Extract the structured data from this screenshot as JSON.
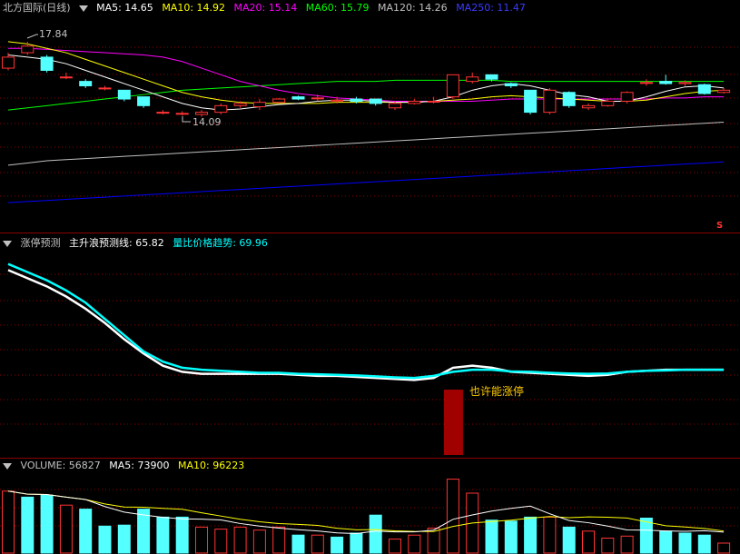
{
  "stock": {
    "name": "北方国际",
    "period": "(日线)",
    "title_color": "#c0c0c0"
  },
  "price_panel": {
    "indicators": [
      {
        "label": "MA5: 14.65",
        "color": "#ffffff"
      },
      {
        "label": "MA10: 14.92",
        "color": "#ffff00"
      },
      {
        "label": "MA20: 15.14",
        "color": "#ff00ff"
      },
      {
        "label": "MA60: 15.79",
        "color": "#00ff00"
      },
      {
        "label": "MA120: 14.26",
        "color": "#c0c0c0"
      },
      {
        "label": "MA250: 11.47",
        "color": "#0000ff"
      }
    ],
    "high_marker": "17.84",
    "low_marker": "14.09",
    "corner_mark": "S"
  },
  "indicator_panel": {
    "name": "涨停预测",
    "lines": [
      {
        "label": "主升浪预测线: 65.82",
        "color": "#ffffff"
      },
      {
        "label": "量比价格趋势: 69.96",
        "color": "#00ffff"
      }
    ],
    "signal_text": "也许能涨停",
    "signal_color": "#ffcc00"
  },
  "volume_panel": {
    "name": "VOLUME: 56827",
    "indicators": [
      {
        "label": "MA5: 73900",
        "color": "#ffffff"
      },
      {
        "label": "MA10: 96223",
        "color": "#ffff00"
      }
    ]
  },
  "colors": {
    "up": "#ff3333",
    "down": "#54ffff",
    "separator": "#8b0000",
    "grid": "#8b0000"
  },
  "candles": [
    {
      "o": 15.6,
      "c": 16.1,
      "h": 16.3,
      "l": 15.5
    },
    {
      "o": 16.3,
      "c": 16.6,
      "h": 16.8,
      "l": 16.2
    },
    {
      "o": 16.1,
      "c": 15.5,
      "h": 16.2,
      "l": 15.4
    },
    {
      "o": 15.2,
      "c": 15.2,
      "h": 15.4,
      "l": 15.1
    },
    {
      "o": 15.0,
      "c": 14.8,
      "h": 15.1,
      "l": 14.7
    },
    {
      "o": 14.7,
      "c": 14.7,
      "h": 14.8,
      "l": 14.6
    },
    {
      "o": 14.6,
      "c": 14.2,
      "h": 14.6,
      "l": 14.1
    },
    {
      "o": 14.3,
      "c": 13.9,
      "h": 14.3,
      "l": 13.8
    },
    {
      "o": 13.6,
      "c": 13.6,
      "h": 13.7,
      "l": 13.5
    },
    {
      "o": 13.55,
      "c": 13.55,
      "h": 13.65,
      "l": 13.45
    },
    {
      "o": 13.5,
      "c": 13.6,
      "h": 13.7,
      "l": 13.4
    },
    {
      "o": 13.6,
      "c": 13.9,
      "h": 14.0,
      "l": 13.5
    },
    {
      "o": 13.9,
      "c": 14.0,
      "h": 14.1,
      "l": 13.8
    },
    {
      "o": 13.85,
      "c": 14.05,
      "h": 14.2,
      "l": 13.7
    },
    {
      "o": 14.05,
      "c": 14.2,
      "h": 14.25,
      "l": 14.0
    },
    {
      "o": 14.3,
      "c": 14.2,
      "h": 14.35,
      "l": 14.15
    },
    {
      "o": 14.25,
      "c": 14.25,
      "h": 14.4,
      "l": 14.1
    },
    {
      "o": 14.15,
      "c": 14.15,
      "h": 14.3,
      "l": 14.0
    },
    {
      "o": 14.2,
      "c": 14.1,
      "h": 14.3,
      "l": 14.0
    },
    {
      "o": 14.2,
      "c": 14.0,
      "h": 14.2,
      "l": 13.9
    },
    {
      "o": 13.8,
      "c": 14.0,
      "h": 14.1,
      "l": 13.7
    },
    {
      "o": 14.0,
      "c": 14.1,
      "h": 14.2,
      "l": 13.95
    },
    {
      "o": 14.1,
      "c": 14.1,
      "h": 14.3,
      "l": 14.0
    },
    {
      "o": 14.3,
      "c": 15.3,
      "h": 15.3,
      "l": 14.2
    },
    {
      "o": 15.0,
      "c": 15.2,
      "h": 15.4,
      "l": 14.9
    },
    {
      "o": 15.3,
      "c": 15.1,
      "h": 15.3,
      "l": 15.0
    },
    {
      "o": 14.9,
      "c": 14.8,
      "h": 14.95,
      "l": 14.7
    },
    {
      "o": 14.6,
      "c": 13.6,
      "h": 14.6,
      "l": 13.5
    },
    {
      "o": 13.6,
      "c": 14.6,
      "h": 14.7,
      "l": 13.5
    },
    {
      "o": 14.5,
      "c": 13.9,
      "h": 14.55,
      "l": 13.8
    },
    {
      "o": 13.8,
      "c": 13.9,
      "h": 14.0,
      "l": 13.7
    },
    {
      "o": 13.9,
      "c": 14.1,
      "h": 14.2,
      "l": 13.85
    },
    {
      "o": 14.1,
      "c": 14.5,
      "h": 14.55,
      "l": 14.0
    },
    {
      "o": 14.95,
      "c": 14.95,
      "h": 15.1,
      "l": 14.8
    },
    {
      "o": 15.0,
      "c": 14.9,
      "h": 15.3,
      "l": 14.85
    },
    {
      "o": 14.9,
      "c": 14.95,
      "h": 15.05,
      "l": 14.8
    },
    {
      "o": 14.85,
      "c": 14.45,
      "h": 14.9,
      "l": 14.4
    },
    {
      "o": 14.5,
      "c": 14.6,
      "h": 14.7,
      "l": 14.45
    }
  ],
  "volume_bars": [
    {
      "v": 62,
      "up": true
    },
    {
      "v": 56,
      "up": false
    },
    {
      "v": 58,
      "up": false
    },
    {
      "v": 48,
      "up": true
    },
    {
      "v": 44,
      "up": false
    },
    {
      "v": 27,
      "up": false
    },
    {
      "v": 28,
      "up": false
    },
    {
      "v": 44,
      "up": false
    },
    {
      "v": 36,
      "up": false
    },
    {
      "v": 36,
      "up": false
    },
    {
      "v": 26,
      "up": true
    },
    {
      "v": 24,
      "up": true
    },
    {
      "v": 26,
      "up": true
    },
    {
      "v": 23,
      "up": true
    },
    {
      "v": 26,
      "up": true
    },
    {
      "v": 18,
      "up": false
    },
    {
      "v": 18,
      "up": true
    },
    {
      "v": 16,
      "up": false
    },
    {
      "v": 20,
      "up": false
    },
    {
      "v": 38,
      "up": false
    },
    {
      "v": 14,
      "up": true
    },
    {
      "v": 18,
      "up": true
    },
    {
      "v": 25,
      "up": true
    },
    {
      "v": 74,
      "up": true
    },
    {
      "v": 60,
      "up": true
    },
    {
      "v": 33,
      "up": false
    },
    {
      "v": 32,
      "up": false
    },
    {
      "v": 36,
      "up": false
    },
    {
      "v": 36,
      "up": true
    },
    {
      "v": 26,
      "up": false
    },
    {
      "v": 22,
      "up": true
    },
    {
      "v": 15,
      "up": true
    },
    {
      "v": 17,
      "up": true
    },
    {
      "v": 35,
      "up": false
    },
    {
      "v": 22,
      "up": false
    },
    {
      "v": 20,
      "up": false
    },
    {
      "v": 18,
      "up": false
    },
    {
      "v": 10,
      "up": true
    }
  ],
  "ma_lines": {
    "ma5": [
      16.2,
      16.1,
      16.0,
      15.8,
      15.5,
      15.2,
      14.9,
      14.6,
      14.3,
      14.0,
      13.8,
      13.7,
      13.75,
      13.85,
      13.95,
      14.0,
      14.1,
      14.15,
      14.15,
      14.1,
      14.05,
      14.05,
      14.1,
      14.3,
      14.6,
      14.8,
      14.9,
      14.8,
      14.6,
      14.4,
      14.3,
      14.1,
      14.1,
      14.3,
      14.55,
      14.75,
      14.8,
      14.7
    ],
    "ma10": [
      16.8,
      16.7,
      16.5,
      16.3,
      16.0,
      15.7,
      15.4,
      15.1,
      14.8,
      14.5,
      14.3,
      14.15,
      14.05,
      14.0,
      14.0,
      14.0,
      14.0,
      14.05,
      14.05,
      14.05,
      14.05,
      14.05,
      14.1,
      14.15,
      14.2,
      14.3,
      14.35,
      14.3,
      14.25,
      14.2,
      14.15,
      14.1,
      14.1,
      14.15,
      14.3,
      14.45,
      14.55,
      14.6
    ],
    "ma20": [
      16.5,
      16.5,
      16.45,
      16.4,
      16.35,
      16.3,
      16.25,
      16.2,
      16.1,
      15.9,
      15.6,
      15.3,
      15.0,
      14.8,
      14.6,
      14.45,
      14.35,
      14.25,
      14.2,
      14.15,
      14.1,
      14.1,
      14.1,
      14.1,
      14.1,
      14.15,
      14.2,
      14.2,
      14.2,
      14.2,
      14.2,
      14.2,
      14.2,
      14.2,
      14.25,
      14.25,
      14.3,
      14.3
    ],
    "ma60": [
      13.7,
      13.8,
      13.9,
      14.0,
      14.1,
      14.2,
      14.3,
      14.4,
      14.5,
      14.6,
      14.65,
      14.7,
      14.75,
      14.8,
      14.85,
      14.9,
      14.95,
      15.0,
      15.0,
      15.0,
      15.05,
      15.05,
      15.05,
      15.05,
      15.05,
      15.05,
      15.0,
      15.0,
      15.0,
      15.0,
      15.0,
      15.0,
      15.0,
      15.0,
      15.0,
      15.0,
      15.0,
      15.0
    ],
    "ma120": [
      11.2,
      11.3,
      11.4,
      11.45,
      11.5,
      11.55,
      11.6,
      11.65,
      11.7,
      11.75,
      11.8,
      11.85,
      11.9,
      11.95,
      12.0,
      12.05,
      12.1,
      12.15,
      12.2,
      12.25,
      12.3,
      12.35,
      12.4,
      12.45,
      12.5,
      12.55,
      12.6,
      12.65,
      12.7,
      12.75,
      12.8,
      12.85,
      12.9,
      12.95,
      13.0,
      13.05,
      13.1,
      13.15
    ],
    "ma250": [
      9.5,
      9.55,
      9.6,
      9.65,
      9.7,
      9.75,
      9.8,
      9.85,
      9.9,
      9.95,
      10.0,
      10.05,
      10.1,
      10.15,
      10.2,
      10.25,
      10.3,
      10.35,
      10.4,
      10.45,
      10.5,
      10.55,
      10.6,
      10.65,
      10.7,
      10.75,
      10.8,
      10.85,
      10.9,
      10.95,
      11.0,
      11.05,
      11.1,
      11.15,
      11.2,
      11.25,
      11.3,
      11.35
    ]
  },
  "indicator_lines": {
    "main_wave": [
      90,
      86,
      82,
      77,
      71,
      64,
      56,
      49,
      43,
      40,
      39,
      39,
      39,
      39,
      39,
      38.5,
      38,
      38,
      37.5,
      37,
      36.5,
      36,
      37,
      42,
      43,
      42,
      40,
      39.5,
      39,
      38.5,
      38,
      38.5,
      40,
      40.5,
      41,
      41,
      41,
      41
    ],
    "vol_price": [
      93,
      89,
      85,
      80,
      74,
      66,
      58,
      50,
      45,
      42,
      41,
      40.5,
      40,
      39.5,
      39.5,
      39,
      38.8,
      38.5,
      38.2,
      37.8,
      37.3,
      37,
      38,
      40,
      41,
      41,
      40.2,
      40,
      39.5,
      39.2,
      39,
      39.2,
      40,
      40.5,
      40.7,
      41,
      41,
      41
    ]
  }
}
